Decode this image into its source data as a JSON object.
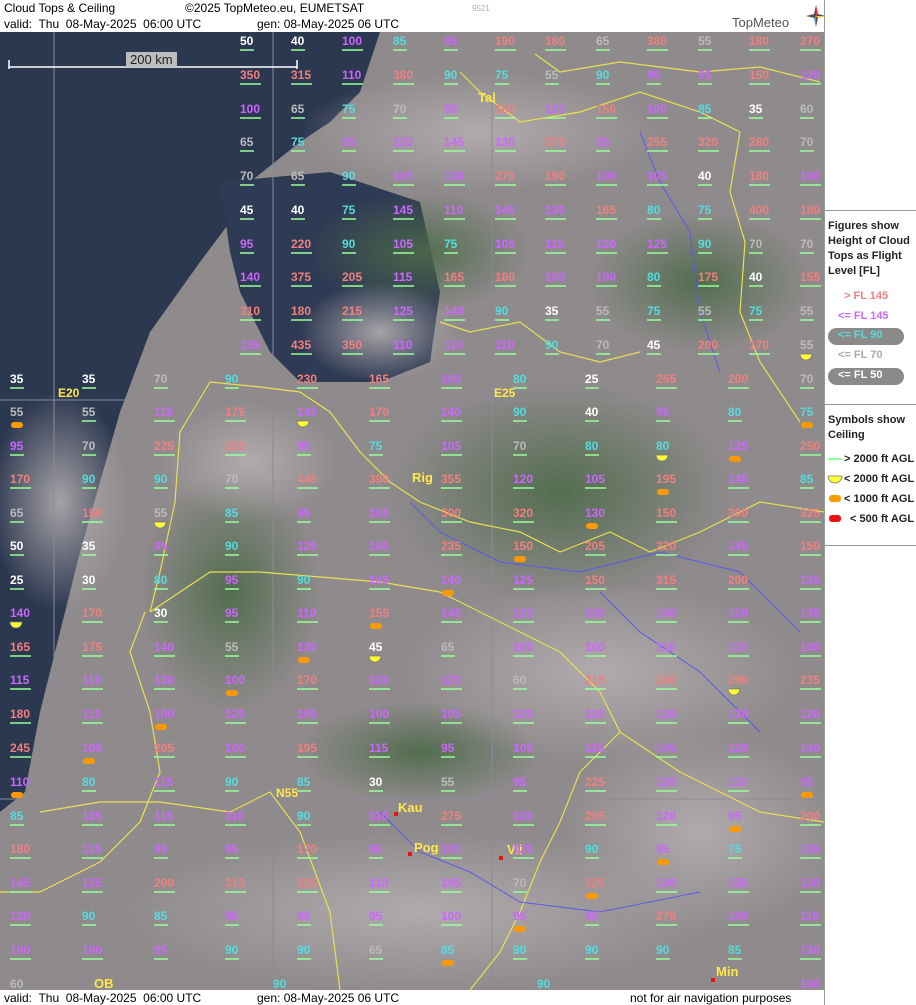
{
  "header": {
    "title": "Cloud Tops & Ceiling",
    "copyright": "©2025 TopMeteo.eu, EUMETSAT",
    "image_num": "9521",
    "valid": "valid:  Thu  08-May-2025  06:00 UTC",
    "generated": "gen: 08-May-2025 06 UTC",
    "brand": "TopMeteo"
  },
  "footer": {
    "valid": "valid:  Thu  08-May-2025  06:00 UTC",
    "generated": "gen: 08-May-2025 06 UTC",
    "disclaimer": "not for air navigation purposes"
  },
  "scale": {
    "label": "200 km"
  },
  "legend": {
    "tops_title": "Figures show\nHeight of Cloud\nTops as Flight\nLevel  [FL]",
    "tops": [
      {
        "label": "> FL 145",
        "color": "#f08080",
        "oval": false
      },
      {
        "label": "<= FL 145",
        "color": "#cc66ff",
        "oval": false
      },
      {
        "label": "<= FL 90",
        "color": "#55dddd",
        "oval": true
      },
      {
        "label": "<= FL 70",
        "color": "#aaaaaa",
        "oval": false
      },
      {
        "label": "<= FL 50",
        "color": "#ffffff",
        "oval": true
      }
    ],
    "ceiling_title": "Symbols show\nCeiling",
    "ceiling": [
      {
        "label": "> 2000 ft AGL",
        "symbol": "line",
        "color": "#99ff99"
      },
      {
        "label": "< 2000 ft AGL",
        "symbol": "half-yellow",
        "color": "#ffff33"
      },
      {
        "label": "< 1000 ft AGL",
        "symbol": "orange-bar",
        "color": "#ff9900"
      },
      {
        "label": "< 500 ft AGL",
        "symbol": "red-bar",
        "color": "#ee1111"
      }
    ]
  },
  "cities": [
    "Tal",
    "Rig",
    "Kau",
    "Pog",
    "Vil",
    "Min",
    "OB"
  ],
  "grid_labels": [
    "E20",
    "E25",
    "N55"
  ],
  "labels": [
    "50",
    "40",
    "100",
    "85",
    "95",
    "190",
    "180",
    "65",
    "380",
    "55",
    "180",
    "270",
    "350",
    "315",
    "110",
    "380",
    "90",
    "75",
    "55",
    "90",
    "95",
    "95",
    "150",
    "120",
    "100",
    "65",
    "75",
    "70",
    "95",
    "160",
    "120",
    "150",
    "100",
    "85",
    "35",
    "60",
    "65",
    "75",
    "95",
    "120",
    "145",
    "130",
    "170",
    "95",
    "255",
    "320",
    "280",
    "70",
    "70",
    "65",
    "90",
    "105",
    "130",
    "275",
    "190",
    "100",
    "105",
    "40",
    "180",
    "100",
    "45",
    "40",
    "75",
    "145",
    "110",
    "145",
    "130",
    "165",
    "80",
    "75",
    "400",
    "180",
    "95",
    "220",
    "90",
    "105",
    "75",
    "105",
    "115",
    "120",
    "125",
    "90",
    "70",
    "70",
    "140",
    "375",
    "205",
    "115",
    "165",
    "180",
    "100",
    "100",
    "80",
    "175",
    "40",
    "155",
    "310",
    "180",
    "215",
    "125",
    "140",
    "90",
    "35",
    "55",
    "75",
    "55",
    "75",
    "55",
    "135",
    "435",
    "350",
    "110",
    "110",
    "110",
    "90",
    "70",
    "45",
    "200",
    "170",
    "55",
    "35",
    "35",
    "70",
    "90",
    "230",
    "165",
    "100",
    "80",
    "25",
    "255",
    "200",
    "70",
    "55",
    "55",
    "115",
    "175",
    "145",
    "170",
    "140",
    "90",
    "40",
    "95",
    "80",
    "75",
    "95",
    "70",
    "225",
    "155",
    "95",
    "75",
    "105",
    "70",
    "80",
    "80",
    "125",
    "250",
    "170",
    "90",
    "90",
    "70",
    "445",
    "390",
    "355",
    "120",
    "105",
    "195",
    "145",
    "85",
    "65",
    "150",
    "55",
    "85",
    "95",
    "105",
    "300",
    "320",
    "130",
    "150",
    "300",
    "325",
    "50",
    "35",
    "95",
    "90",
    "125",
    "145",
    "235",
    "150",
    "205",
    "220",
    "145",
    "150",
    "25",
    "30",
    "80",
    "95",
    "90",
    "105",
    "140",
    "125",
    "150",
    "315",
    "200",
    "135",
    "140",
    "170",
    "30",
    "95",
    "110",
    "155",
    "145",
    "120",
    "130",
    "140",
    "120",
    "135",
    "165",
    "175",
    "140",
    "55",
    "130",
    "45",
    "65",
    "105",
    "100",
    "110",
    "110",
    "100",
    "115",
    "110",
    "120",
    "100",
    "170",
    "130",
    "120",
    "60",
    "215",
    "240",
    "290",
    "235",
    "180",
    "110",
    "100",
    "120",
    "105",
    "100",
    "105",
    "120",
    "130",
    "120",
    "130",
    "120",
    "245",
    "105",
    "205",
    "100",
    "195",
    "115",
    "95",
    "105",
    "115",
    "145",
    "120",
    "140",
    "110",
    "80",
    "115",
    "90",
    "85",
    "30",
    "55",
    "95",
    "225",
    "120",
    "110",
    "95",
    "85",
    "125",
    "115",
    "110",
    "90",
    "110",
    "275",
    "130",
    "205",
    "120",
    "95",
    "200",
    "180",
    "115",
    "95",
    "95",
    "170",
    "95",
    "100",
    "120",
    "90",
    "95",
    "75",
    "135",
    "145",
    "125",
    "200",
    "210",
    "225",
    "110",
    "105",
    "70",
    "225",
    "100",
    "125",
    "130",
    "120",
    "90",
    "85",
    "95",
    "95",
    "95",
    "100",
    "95",
    "95",
    "275",
    "100",
    "115",
    "100",
    "100",
    "95",
    "90",
    "90",
    "65",
    "85",
    "90",
    "90",
    "90",
    "85",
    "130",
    "60",
    "90",
    "90",
    "100"
  ]
}
